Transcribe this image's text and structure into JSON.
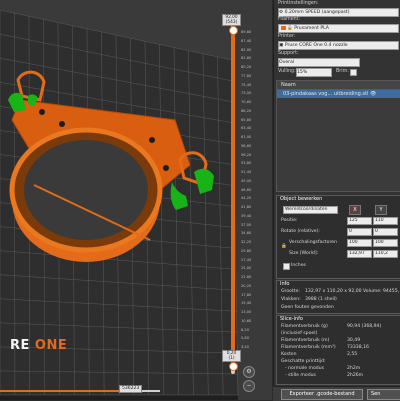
{
  "viewport": {
    "logo_prefix": "RE",
    "logo_suffix": "ONE",
    "layer_top_height": "92,00",
    "layer_top_number": "(543)",
    "layer_bottom_height": "0,20",
    "layer_bottom_number": "(1)",
    "gcode_move_count": "536223",
    "ticks": [
      "89,80",
      "87,40",
      "85,00",
      "82,60",
      "80,20",
      "77,80",
      "75,40",
      "73,00",
      "70,60",
      "68,20",
      "65,80",
      "63,40",
      "61,00",
      "58,60",
      "56,20",
      "53,80",
      "51,40",
      "49,00",
      "46,60",
      "44,20",
      "41,80",
      "39,40",
      "37,00",
      "34,60",
      "32,20",
      "29,80",
      "27,40",
      "25,00",
      "22,60",
      "20,20",
      "17,80",
      "15,40",
      "13,00",
      "10,60",
      "8,20",
      "5,80",
      "3,40"
    ],
    "colors": {
      "model": "#e36b1a",
      "support": "#17b317",
      "bed": "#2e2e2e",
      "grid": "#5a5a5a",
      "slider_active": "#e36b1a"
    }
  },
  "panel": {
    "print_settings_label": "Printinstellingen:",
    "print_settings_value": "0.20mm SPEED (aangepast)",
    "filament_label": "Filament:",
    "filament_value": "Prusament PLA",
    "filament_color": "#e36b1a",
    "printer_label": "Printer:",
    "printer_value": "Pruse CORE One 0.4 nozzle",
    "support_label": "Support:",
    "support_value": "Overal",
    "infill_label": "Vulling:",
    "infill_value": "15%",
    "brim_label": "Brim:",
    "list_header": "Naam",
    "object_name": "03-pindakaas vog... uitbreiding.stl",
    "object_manip": {
      "title": "Object bewerken",
      "coord_mode": "Wereldcoördinaten",
      "axis_x": "X",
      "axis_y": "Y",
      "position_label": "Positie:",
      "position_x": "125",
      "position_y": "110",
      "rotate_label": "Rotate (relative):",
      "rotate_x": "0",
      "rotate_y": "0",
      "scale_label": "Verschalingsfactoren",
      "scale_x": "100",
      "scale_y": "100",
      "size_label": "Size [World]:",
      "size_x": "132,97",
      "size_y": "110,2",
      "inches_label": "Inches"
    },
    "info": {
      "title": "Info",
      "size_label": "Grootte:",
      "size_value": "132,97 x 110,20 x 92,00",
      "volume_label": "Volume:",
      "volume_value": "94455,",
      "facets_label": "Vlakken:",
      "facets_value": "3988 (1 shell)",
      "errors": "Geen fouten gevonden"
    },
    "slice_info": {
      "title": "Slice-info",
      "rows": [
        {
          "label": "Filamentverbruik (g)",
          "value": "90,94 (368,94)"
        },
        {
          "label": "(inclusief spoel)",
          "value": ""
        },
        {
          "label": "Filamentverbruik (m)",
          "value": "30,49"
        },
        {
          "label": "Filamentverbruik (mm³)",
          "value": "73338,16"
        },
        {
          "label": "Kosten",
          "value": "2,55"
        },
        {
          "label": "Geschatte printtijd:",
          "value": ""
        },
        {
          "label": "- normale modus",
          "value": "2h2m"
        },
        {
          "label": "- stille modus",
          "value": "2h26m"
        }
      ]
    },
    "export_button": "Exporteer .gcode-bestand",
    "send_button": "Sen"
  }
}
